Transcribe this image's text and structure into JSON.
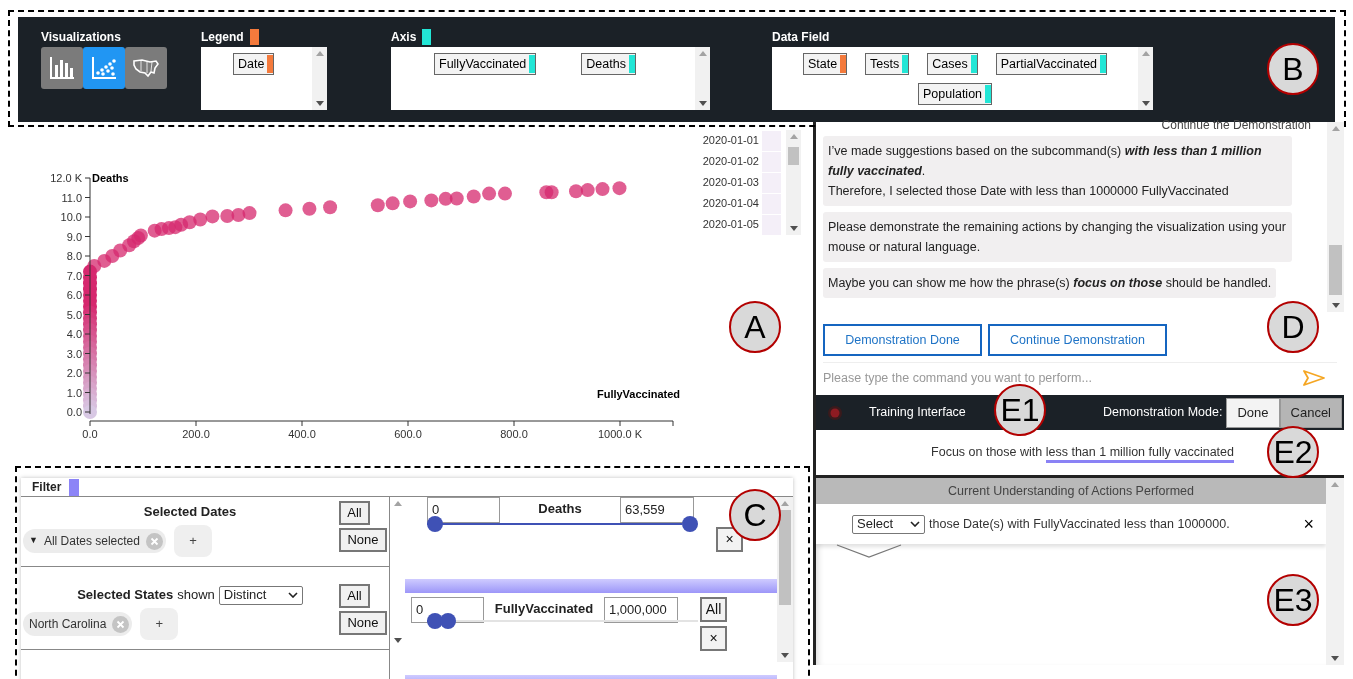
{
  "toolbar": {
    "visualizations": {
      "label": "Visualizations",
      "options": [
        {
          "kind": "bar",
          "selected": false
        },
        {
          "kind": "scatter",
          "selected": true
        },
        {
          "kind": "map",
          "selected": false
        }
      ]
    },
    "legend": {
      "label": "Legend",
      "color": "#f47a3c",
      "fields": [
        {
          "label": "Date",
          "color": "#f47a3c"
        }
      ]
    },
    "axis": {
      "label": "Axis",
      "color": "#22e6d6",
      "fields": [
        {
          "label": "FullyVaccinated",
          "color": "#22e6d6"
        },
        {
          "label": "Deaths",
          "color": "#22e6d6"
        }
      ]
    },
    "data_field": {
      "label": "Data Field",
      "fields": [
        {
          "label": "State",
          "color": "#f47a3c"
        },
        {
          "label": "Tests",
          "color": "#22e6d6"
        },
        {
          "label": "Cases",
          "color": "#22e6d6"
        },
        {
          "label": "PartialVaccinated",
          "color": "#22e6d6"
        },
        {
          "label": "Population",
          "color": "#22e6d6"
        }
      ]
    }
  },
  "chart": {
    "chart_data": {
      "type": "scatter",
      "xlabel": "FullyVaccinated",
      "ylabel": "Deaths",
      "x": [
        0,
        0,
        0,
        0,
        0,
        0,
        0,
        0,
        0,
        0,
        0,
        0,
        0,
        0,
        0,
        0,
        0,
        0,
        0,
        0,
        0,
        0,
        0,
        0,
        0,
        8,
        27,
        42,
        57,
        74,
        83,
        91,
        96,
        122,
        135,
        149,
        161,
        172,
        188,
        208,
        231,
        259,
        280,
        301,
        369,
        414,
        453,
        543,
        571,
        604,
        644,
        671,
        692,
        724,
        753,
        783,
        861,
        871,
        917,
        939,
        967,
        999
      ],
      "series": [
        {
          "values": [
            0,
            0.3,
            0.6,
            0.9,
            1.2,
            1.5,
            1.8,
            2.1,
            2.4,
            2.7,
            3.0,
            3.3,
            3.6,
            3.9,
            4.2,
            4.5,
            4.8,
            5.1,
            5.4,
            5.7,
            6.0,
            6.3,
            6.6,
            6.9,
            7.2,
            7.49,
            7.75,
            8.0,
            8.28,
            8.55,
            8.76,
            8.92,
            9.05,
            9.3,
            9.38,
            9.43,
            9.48,
            9.6,
            9.73,
            9.87,
            10.03,
            10.05,
            10.1,
            10.2,
            10.34,
            10.42,
            10.5,
            10.6,
            10.7,
            10.8,
            10.85,
            10.93,
            10.95,
            11.05,
            11.2,
            11.2,
            11.27,
            11.27,
            11.32,
            11.38,
            11.43,
            11.48
          ]
        }
      ],
      "xlim": [
        0,
        1100
      ],
      "ylim": [
        0,
        12
      ],
      "xticks": [
        {
          "value": 0,
          "label": "0.0"
        },
        {
          "value": 200,
          "label": "200.0"
        },
        {
          "value": 400,
          "label": "400.0"
        },
        {
          "value": 600,
          "label": "600.0"
        },
        {
          "value": 800,
          "label": "800.0"
        },
        {
          "value": 1000,
          "label": "1000.0 K"
        }
      ],
      "yticks": [
        {
          "value": 0,
          "label": "0.0"
        },
        {
          "value": 1,
          "label": "1.0"
        },
        {
          "value": 2,
          "label": "2.0"
        },
        {
          "value": 3,
          "label": "3.0"
        },
        {
          "value": 4,
          "label": "4.0"
        },
        {
          "value": 5,
          "label": "5.0"
        },
        {
          "value": 6,
          "label": "6.0"
        },
        {
          "value": 7,
          "label": "7.0"
        },
        {
          "value": 8,
          "label": "8.0"
        },
        {
          "value": 9,
          "label": "9.0"
        },
        {
          "value": 10,
          "label": "10.0"
        },
        {
          "value": 11,
          "label": "11.0"
        },
        {
          "value": 12,
          "label": "12.0 K"
        }
      ]
    },
    "date_legend": [
      "2020-01-01",
      "2020-01-02",
      "2020-01-03",
      "2020-01-04",
      "2020-01-05"
    ]
  },
  "filter": {
    "label": "Filter",
    "color": "#8c84f7",
    "lists": [
      {
        "title": "Selected Dates",
        "chips": [
          {
            "caret": "▼",
            "label": "All Dates selected"
          }
        ],
        "add": "+",
        "buttons": [
          "All",
          "None"
        ]
      },
      {
        "title": "Selected States",
        "suffix": "shown",
        "mode": "Distinct",
        "chips": [
          {
            "label": "North Carolina"
          }
        ],
        "add": "+",
        "buttons": [
          "All",
          "None"
        ]
      }
    ],
    "sliders": [
      {
        "min": "0",
        "label": "Deaths",
        "max": "63,559",
        "buttons": [
          "×"
        ],
        "low_thumb": {
          "level": 0
        },
        "high_thumb": {
          "level": 1
        }
      },
      {
        "min": "0",
        "label": "FullyVaccinated",
        "max": "1,000,000",
        "buttons": [
          "All",
          "×"
        ],
        "low_thumb": {
          "level": 0
        },
        "high_thumb": {
          "level": 0.05
        }
      }
    ]
  },
  "chat": {
    "top_text": "Continue the Demonstration",
    "messages": [
      {
        "paragraphs": [
          "I’ve made suggestions based on the subcommand(s) **with less than 1 million fully vaccinated**.",
          "Therefore, I selected those Date with less than 1000000 FullyVaccinated"
        ]
      },
      {
        "paragraphs": [
          "Please demonstrate the remaining actions by changing the visualization using your mouse or natural language."
        ]
      },
      {
        "paragraphs": [
          "Maybe you can show me how the phrase(s) **focus on those** should be handled."
        ]
      }
    ],
    "buttons": [
      "Demonstration Done",
      "Continue Demonstration"
    ],
    "input": {
      "placeholder": "Please type the command you want to perform..."
    }
  },
  "training_bar": {
    "title": "Training Interface",
    "mode_label": "Demonstration Mode:",
    "buttons": [
      {
        "label": "Done",
        "selected": true
      },
      {
        "label": "Cancel",
        "selected": false
      }
    ]
  },
  "command": {
    "text": "Focus on those with",
    "highlight": "less than 1 million fully vaccinated"
  },
  "understanding": {
    "title": "Current Understanding of Actions Performed",
    "actions": [
      {
        "verb": "Select",
        "text": "those Date(s) with FullyVaccinated less than 1000000.",
        "close": "×"
      }
    ]
  },
  "callouts": [
    "A",
    "B",
    "C",
    "D",
    "E1",
    "E2",
    "E3"
  ]
}
